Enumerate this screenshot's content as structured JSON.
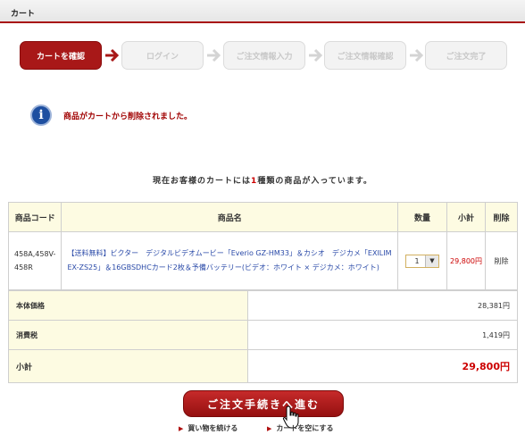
{
  "header": {
    "title": "カート"
  },
  "steps": [
    {
      "label": "カートを確認",
      "state": "active"
    },
    {
      "label": "ログイン",
      "state": "inactive"
    },
    {
      "label": "ご注文情報入力",
      "state": "inactive"
    },
    {
      "label": "ご注文情報確認",
      "state": "inactive"
    },
    {
      "label": "ご注文完了",
      "state": "inactive"
    }
  ],
  "notice": {
    "icon": "info-icon",
    "text": "商品がカートから削除されました。"
  },
  "summary": {
    "prefix": "現在お客様のカートには",
    "count": "1",
    "suffix": "種類の商品が入っています。"
  },
  "cart": {
    "headers": {
      "code": "商品コード",
      "name": "商品名",
      "qty": "数量",
      "subtotal": "小計",
      "delete": "削除"
    },
    "items": [
      {
        "code": "458A,458V-458R",
        "name": "【送料無料】ビクター　デジタルビデオムービー「Everio GZ-HM33」＆カシオ　デジカメ「EXILIM EX-ZS25」＆16GBSDHCカード2枚＆予備バッテリー(ビデオ：ホワイト × デジカメ：ホワイト)",
        "qty": "1",
        "subtotal": "29,800円",
        "delete": "削除"
      }
    ]
  },
  "totals": {
    "base_label": "本体価格",
    "base_value": "28,381円",
    "tax_label": "消費税",
    "tax_value": "1,419円",
    "total_label": "小計",
    "total_value": "29,800円"
  },
  "actions": {
    "proceed": "ご注文手続きへ進む",
    "continue_shopping": "買い物を続ける",
    "empty_cart": "カートを空にする"
  },
  "colors": {
    "accent": "#a81818",
    "highlight_bg": "#fdfbe2",
    "price_red": "#cc0000",
    "link_blue": "#2a4aa8"
  }
}
